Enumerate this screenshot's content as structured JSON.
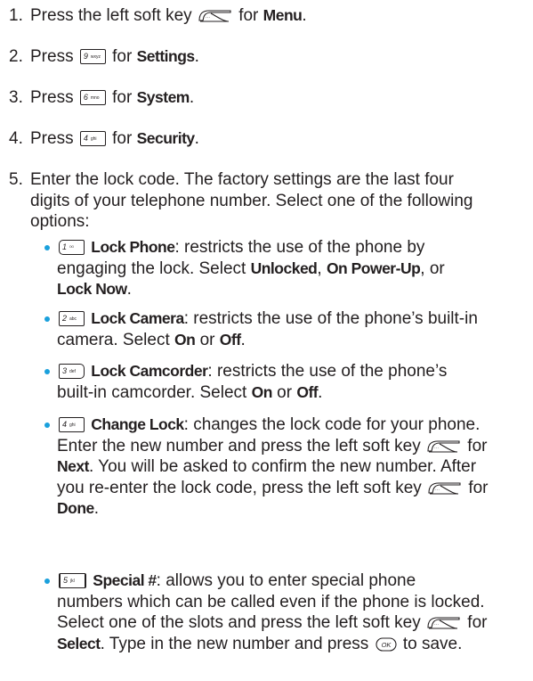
{
  "steps": [
    {
      "num": "1.",
      "pre": "Press the left soft key",
      "post": "for",
      "bold": "Menu",
      "end": "."
    },
    {
      "num": "2.",
      "pre": "Press",
      "key": "9",
      "keysub": "wxyz",
      "post": "for",
      "bold": "Settings",
      "end": "."
    },
    {
      "num": "3.",
      "pre": "Press",
      "key": "6",
      "keysub": "mno",
      "post": "for",
      "bold": "System",
      "end": "."
    },
    {
      "num": "4.",
      "pre": "Press",
      "key": "4",
      "keysub": "ghi",
      "post": "for",
      "bold": "Security",
      "end": "."
    },
    {
      "num": "5.",
      "lines": [
        "Enter the lock code. The factory settings are the last four",
        "digits of your telephone number. Select one of the following",
        "options:"
      ]
    }
  ],
  "options": [
    {
      "key": "1",
      "keysub": "",
      "title": "Lock Phone",
      "l1": ": restricts the use of the phone by",
      "l2": "engaging the lock. Select ",
      "b1": "Unlocked",
      "sep1": ", ",
      "b2": "On Power-Up",
      "sep2": ", or",
      "b3": "Lock Now",
      "end": "."
    },
    {
      "key": "2",
      "keysub": "abc",
      "title": "Lock Camera",
      "l1": ": restricts the use of the phone’s built-in",
      "l2": "camera. Select ",
      "b1": "On",
      "sep1": " or ",
      "b2": "Off",
      "end": "."
    },
    {
      "key": "3",
      "keysub": "def",
      "title": "Lock Camcorder",
      "l1": ": restricts the use of the phone’s",
      "l2": "built-in camcorder. Select ",
      "b1": "On",
      "sep1": " or ",
      "b2": "Off",
      "end": "."
    },
    {
      "key": "4",
      "keysub": "ghi",
      "title": "Change Lock",
      "l1": ": changes the lock code for your phone.",
      "l2": "Enter the new number and press the left soft key",
      "l2b": "for",
      "l3a": "Next",
      "l3": ". You will be asked to confirm the new number. After",
      "l4": "you re-enter the lock code, press the left soft key",
      "l4b": "for",
      "l5a": "Done",
      "l5": "."
    },
    {
      "key": "5",
      "keysub": "jkl",
      "title": "Special #",
      "l1": ": allows you to enter special phone",
      "l2": "numbers which can be called even if the phone is locked.",
      "l3": "Select one of the slots and press the left soft key",
      "l3b": "for",
      "l4a": "Select",
      "l4": ". Type in the new number and press",
      "l4b": "to save.",
      "ok": "OK"
    }
  ]
}
